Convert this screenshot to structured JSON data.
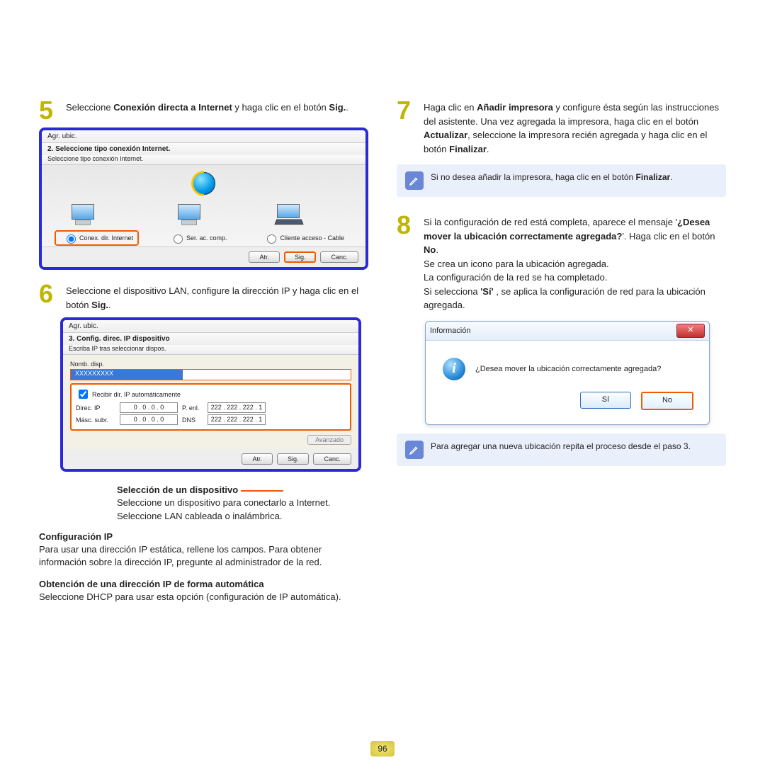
{
  "page_number": "96",
  "left": {
    "step5": {
      "num": "5",
      "text_a": "Seleccione ",
      "text_b": "Conexión directa a Internet",
      "text_c": " y haga clic en el botón ",
      "text_d": "Sig.",
      "text_e": "."
    },
    "dialog1": {
      "title": "Agr. ubic.",
      "sub": "2. Seleccione tipo conexión Internet.",
      "desc": "Seleccione tipo conexión Internet.",
      "opt1": "Conex. dir. Internet",
      "opt2": "Ser. ac. comp.",
      "opt3": "Cliente acceso - Cable",
      "btn_back": "Atr.",
      "btn_next": "Sig.",
      "btn_cancel": "Canc."
    },
    "step6": {
      "num": "6",
      "text_a": "Seleccione el dispositivo LAN, configure la dirección IP y haga clic en el botón ",
      "text_b": "Sig.",
      "text_c": "."
    },
    "dialog2": {
      "title": "Agr. ubic.",
      "sub": "3. Config. direc. IP dispositivo",
      "desc": "Escriba IP tras seleccionar dispos.",
      "name_lbl": "Nomb. disp.",
      "device_value": "XXXXXXXXX",
      "auto_chk": "Recibir dir. IP automáticamente",
      "ip_lbl": "Direc. IP",
      "ip_val": "0  .  0  .  0  .  0",
      "mask_lbl": "Másc. subr.",
      "mask_val": "0  .  0  .  0  .  0",
      "gw_lbl": "P. enl.",
      "gw_val": "222 . 222 . 222 .  1",
      "dns_lbl": "DNS",
      "dns_val": "222 . 222 . 222 .  1",
      "adv": "Avanzado",
      "btn_back": "Atr.",
      "btn_next": "Sig.",
      "btn_cancel": "Canc."
    },
    "callout_device_head": "Selección de un dispositivo",
    "callout_device_text": "Seleccione un dispositivo para conectarlo a Internet. Seleccione LAN cableada o inalámbrica.",
    "callout_ip_head": "Configuración IP",
    "callout_ip_text": "Para usar una dirección IP estática, rellene los campos. Para obtener información sobre la dirección IP, pregunte al administrador de la red.",
    "callout_auto_head": "Obtención de una dirección IP de forma automática",
    "callout_auto_text": "Seleccione DHCP para usar esta opción (configuración de IP automática)."
  },
  "right": {
    "step7": {
      "num": "7",
      "a": "Haga clic en ",
      "b": "Añadir impresora",
      "c": " y configure ésta según las instrucciones del asistente. Una vez agregada la impresora, haga clic en el botón ",
      "d": "Actualizar",
      "e": ", seleccione la impresora recién agregada y haga clic en el botón ",
      "f": "Finalizar",
      "g": "."
    },
    "note1_a": "Si no desea añadir la impresora, haga clic en el botón ",
    "note1_b": "Finalizar",
    "note1_c": ".",
    "step8": {
      "num": "8",
      "a": "Si la configuración de red está completa, aparece el mensaje '",
      "b": "¿Desea mover la ubicación correctamente agregada?",
      "c": "'. Haga clic en el botón ",
      "d": "No",
      "e": ".",
      "f": "Se crea un icono para la ubicación agregada.",
      "g": "La configuración de la red se ha completado.",
      "h": "Si selecciona ",
      "i": "'Sí'",
      "j": " , se aplica la configuración de red para la ubicación agregada."
    },
    "info_dialog": {
      "title": "Información",
      "msg": "¿Desea mover la ubicación correctamente agregada?",
      "yes": "Sí",
      "no": "No"
    },
    "note2": "Para agregar una nueva ubicación repita el proceso desde el paso 3."
  }
}
